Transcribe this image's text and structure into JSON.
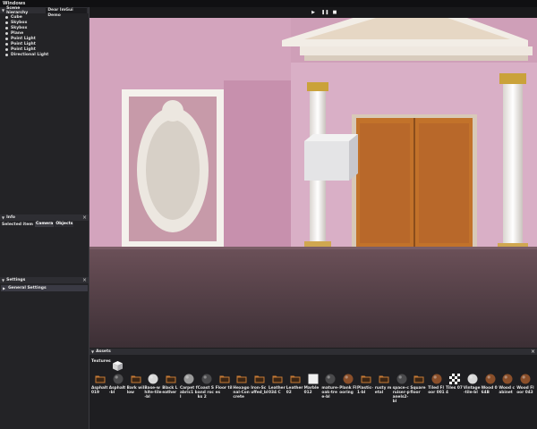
{
  "menubar": {
    "title": "Windows"
  },
  "scene_hierarchy": {
    "title": "Scene hierarchy",
    "demo_tab": "Dear ImGui Demo",
    "items": [
      "Cube",
      "Skybox",
      "Skybox",
      "Plane",
      "Point Light",
      "Point Light",
      "Point Light",
      "Directional Light"
    ]
  },
  "info": {
    "title": "Info",
    "selected_label": "Selected item",
    "tabs": [
      "Camera",
      "Objects"
    ]
  },
  "settings": {
    "title": "Settings",
    "general": "General Settings"
  },
  "assets": {
    "title": "Assets",
    "textures_label": "Textures",
    "items": [
      {
        "name": "Asphalt 019",
        "kind": "folder"
      },
      {
        "name": "Asphalt-bl",
        "kind": "dark"
      },
      {
        "name": "Bark willow",
        "kind": "folder"
      },
      {
        "name": "Base-white-tile-bl",
        "kind": "light"
      },
      {
        "name": "Black Leather",
        "kind": "folder"
      },
      {
        "name": "Carpet fabric1 bl",
        "kind": "gray"
      },
      {
        "name": "Coast Sand rocks 2",
        "kind": "dark"
      },
      {
        "name": "Floor tiles",
        "kind": "folder"
      },
      {
        "name": "Hexagonal-Concrete",
        "kind": "folder"
      },
      {
        "name": "Iron-Scuffed_bl",
        "kind": "folder"
      },
      {
        "name": "Leather 034 C",
        "kind": "folder"
      },
      {
        "name": "Leather 02",
        "kind": "folder"
      },
      {
        "name": "Marble 012",
        "kind": "white"
      },
      {
        "name": "mature-oak-tree-bl",
        "kind": "dark"
      },
      {
        "name": "Plank Flooring",
        "kind": "brown"
      },
      {
        "name": "Plastic-1-bl",
        "kind": "folder"
      },
      {
        "name": "rusty metal",
        "kind": "folder"
      },
      {
        "name": "space-cruiser-panels2-bl",
        "kind": "dark"
      },
      {
        "name": "Square floor",
        "kind": "folder"
      },
      {
        "name": "Tiled Floor 001",
        "kind": "brown"
      },
      {
        "name": "Tiles 074",
        "kind": "checker"
      },
      {
        "name": "Vintage-tile-bl",
        "kind": "light"
      },
      {
        "name": "Wood 064B",
        "kind": "brown"
      },
      {
        "name": "Wood cabinet",
        "kind": "brown"
      },
      {
        "name": "Wood Floor 043",
        "kind": "brown"
      }
    ]
  },
  "colors": {
    "accent": "#3a3a44",
    "wall": "#d6a9c2",
    "door": "#c2722a"
  }
}
